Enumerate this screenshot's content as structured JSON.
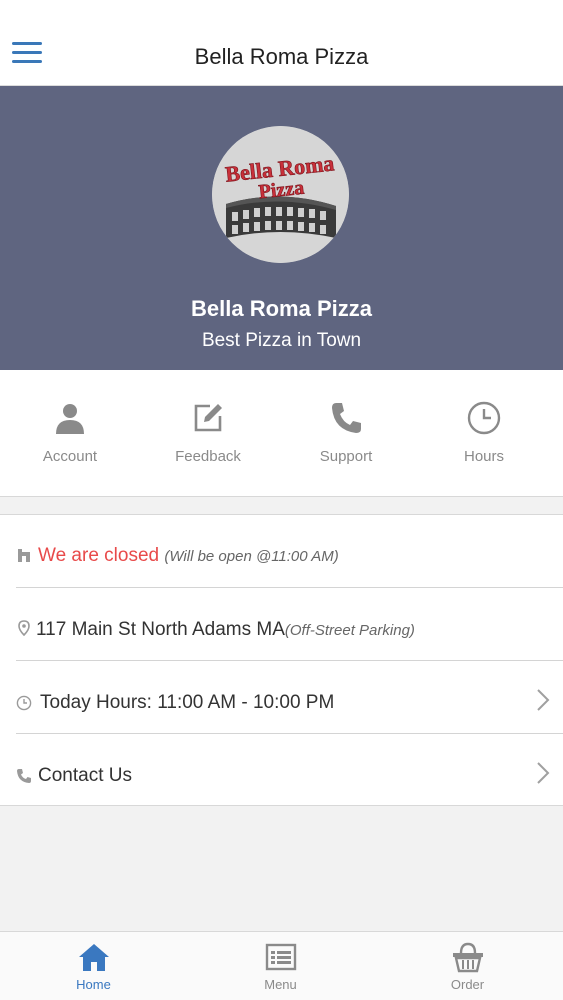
{
  "header": {
    "title": "Bella Roma Pizza"
  },
  "banner": {
    "logo_text_top": "Bella Roma",
    "logo_text_bottom": "Pizza",
    "name": "Bella Roma Pizza",
    "tagline": "Best Pizza in Town"
  },
  "quick_actions": [
    {
      "label": "Account",
      "icon": "user-icon"
    },
    {
      "label": "Feedback",
      "icon": "edit-icon"
    },
    {
      "label": "Support",
      "icon": "phone-icon"
    },
    {
      "label": "Hours",
      "icon": "clock-icon"
    }
  ],
  "info": {
    "status": "We are closed",
    "status_note": "(Will be open @11:00 AM)",
    "address": "117 Main St North Adams MA",
    "address_note": "(Off-Street Parking)",
    "hours": "Today Hours: 11:00 AM - 10:00 PM",
    "contact": "Contact Us"
  },
  "tabs": [
    {
      "label": "Home",
      "active": true
    },
    {
      "label": "Menu",
      "active": false
    },
    {
      "label": "Order",
      "active": false
    }
  ],
  "colors": {
    "accent": "#3a78c0",
    "banner": "#5f6580",
    "closed": "#e84a4a",
    "muted": "#8a8a8a"
  }
}
